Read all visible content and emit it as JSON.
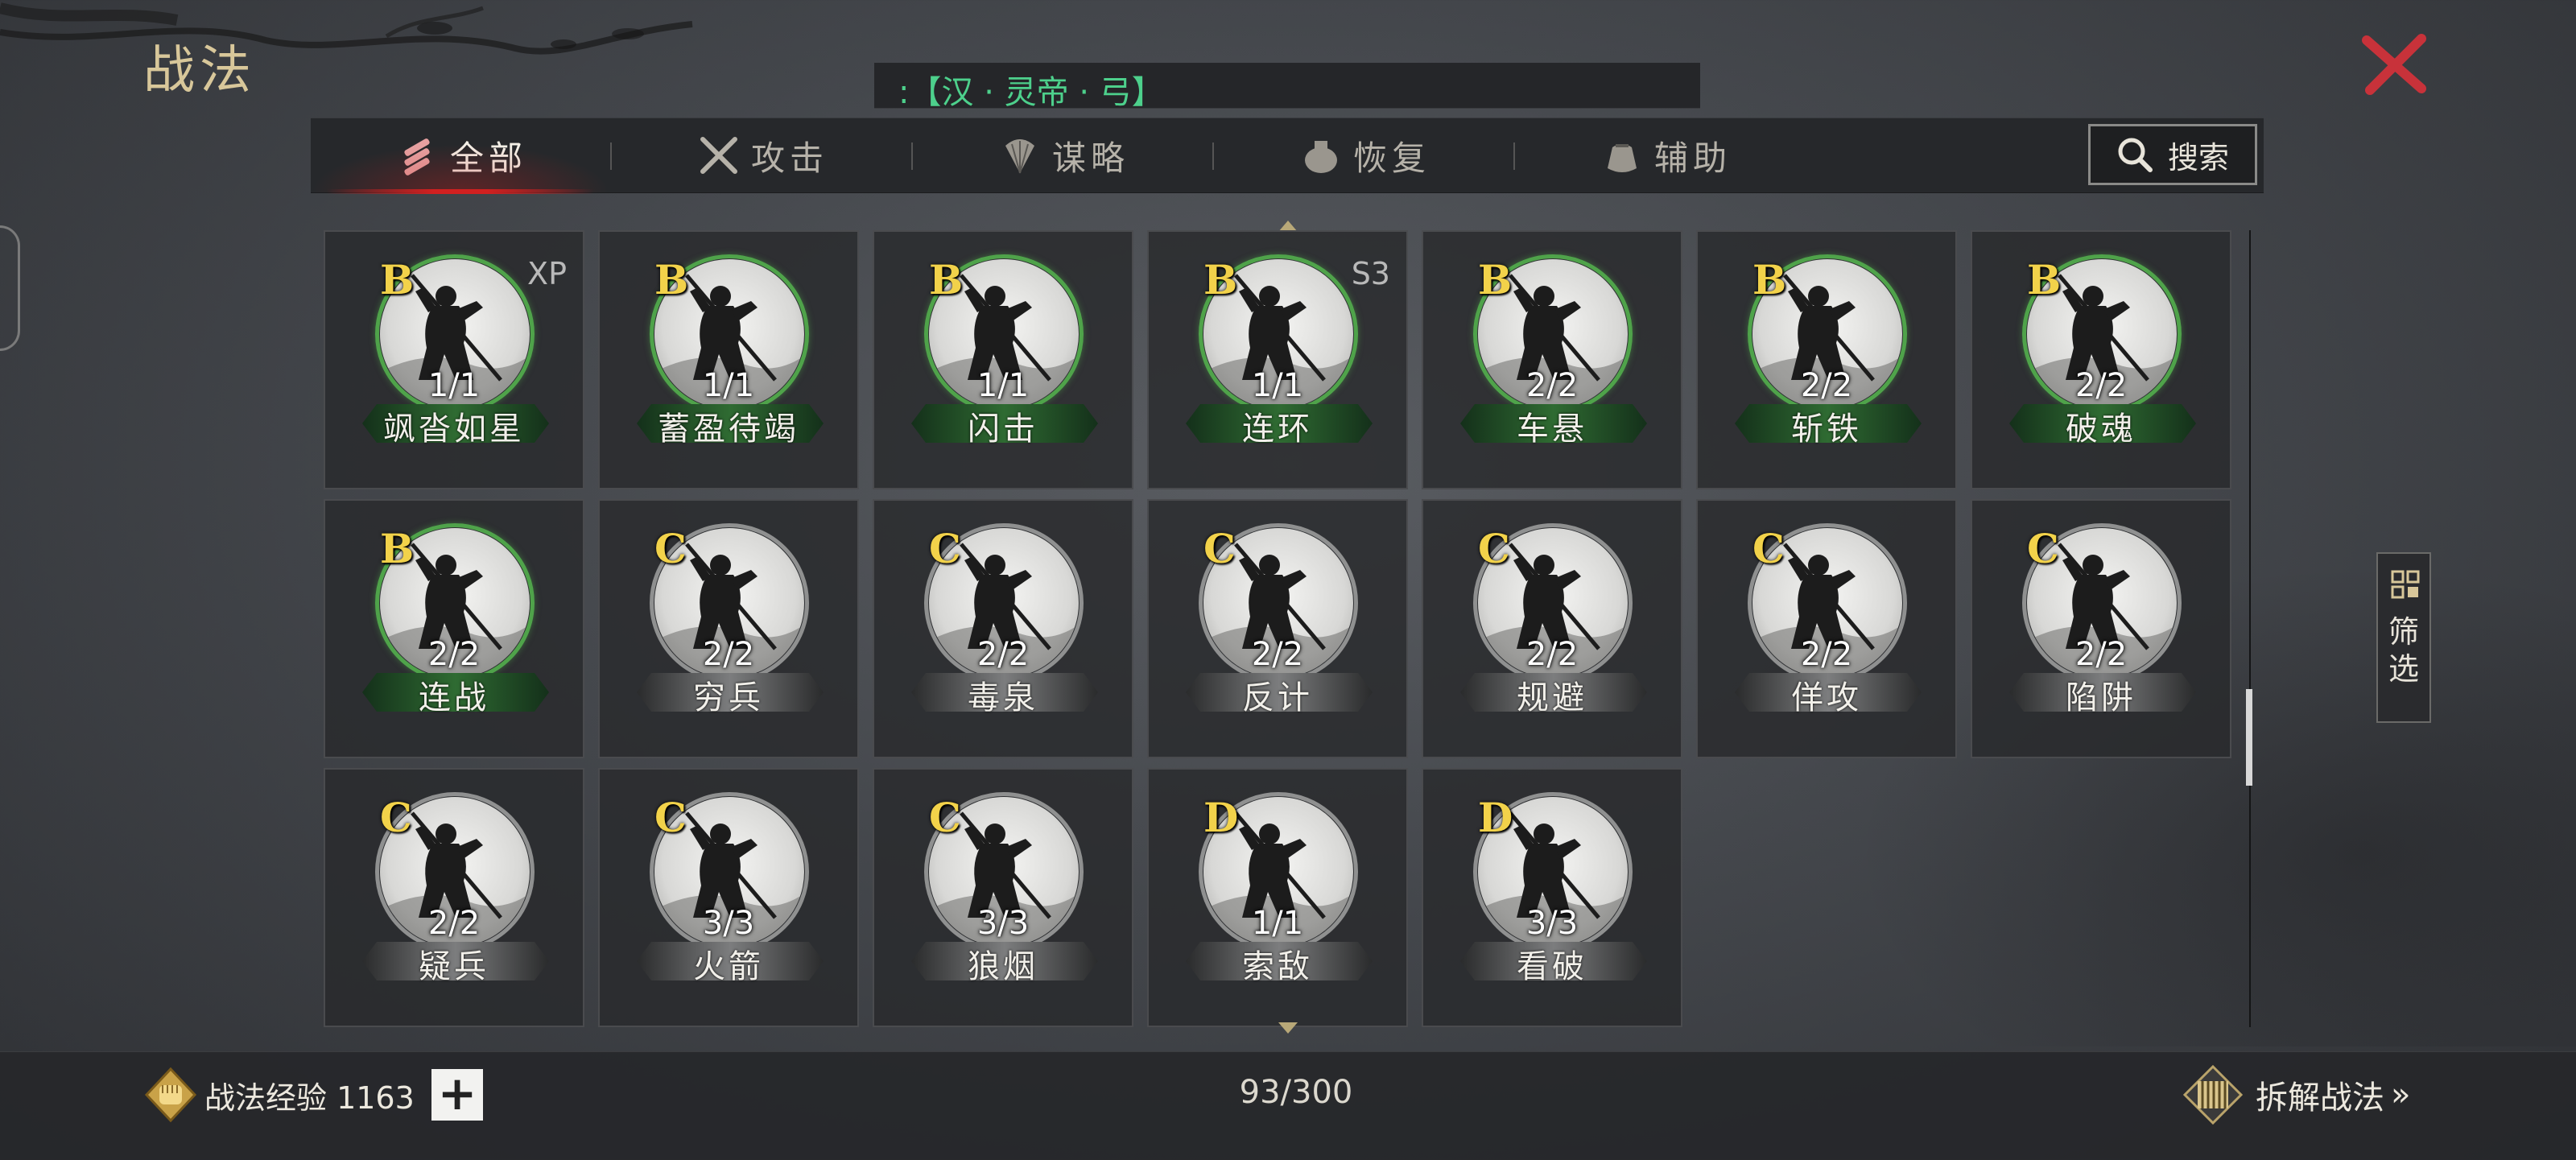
{
  "header": {
    "title": "战法",
    "banner_text": ":【汉 · 灵帝 · 弓】"
  },
  "tabs": [
    {
      "label": "全部",
      "icon": "scroll-bundle-icon",
      "active": true
    },
    {
      "label": "攻击",
      "icon": "crossed-swords-icon",
      "active": false
    },
    {
      "label": "谋略",
      "icon": "feather-fan-icon",
      "active": false
    },
    {
      "label": "恢复",
      "icon": "medicine-pot-icon",
      "active": false
    },
    {
      "label": "辅助",
      "icon": "pouch-icon",
      "active": false
    }
  ],
  "search": {
    "label": "搜索",
    "icon": "magnifier-icon"
  },
  "filter": {
    "label": "筛选",
    "icon": "grid-icon"
  },
  "cards": [
    {
      "grade": "B",
      "level": "1/1",
      "name": "飒沓如星",
      "tag": "XP",
      "tier": "green"
    },
    {
      "grade": "B",
      "level": "1/1",
      "name": "蓄盈待竭",
      "tag": "",
      "tier": "green"
    },
    {
      "grade": "B",
      "level": "1/1",
      "name": "闪击",
      "tag": "",
      "tier": "green"
    },
    {
      "grade": "B",
      "level": "1/1",
      "name": "连环",
      "tag": "S3",
      "tier": "green"
    },
    {
      "grade": "B",
      "level": "2/2",
      "name": "车悬",
      "tag": "",
      "tier": "green"
    },
    {
      "grade": "B",
      "level": "2/2",
      "name": "斩铁",
      "tag": "",
      "tier": "green"
    },
    {
      "grade": "B",
      "level": "2/2",
      "name": "破魂",
      "tag": "",
      "tier": "green"
    },
    {
      "grade": "B",
      "level": "2/2",
      "name": "连战",
      "tag": "",
      "tier": "green"
    },
    {
      "grade": "C",
      "level": "2/2",
      "name": "穷兵",
      "tag": "",
      "tier": "grey"
    },
    {
      "grade": "C",
      "level": "2/2",
      "name": "毒泉",
      "tag": "",
      "tier": "grey"
    },
    {
      "grade": "C",
      "level": "2/2",
      "name": "反计",
      "tag": "",
      "tier": "grey"
    },
    {
      "grade": "C",
      "level": "2/2",
      "name": "规避",
      "tag": "",
      "tier": "grey"
    },
    {
      "grade": "C",
      "level": "2/2",
      "name": "佯攻",
      "tag": "",
      "tier": "grey"
    },
    {
      "grade": "C",
      "level": "2/2",
      "name": "陷阱",
      "tag": "",
      "tier": "grey"
    },
    {
      "grade": "C",
      "level": "2/2",
      "name": "疑兵",
      "tag": "",
      "tier": "grey"
    },
    {
      "grade": "C",
      "level": "3/3",
      "name": "火箭",
      "tag": "",
      "tier": "grey"
    },
    {
      "grade": "C",
      "level": "3/3",
      "name": "狼烟",
      "tag": "",
      "tier": "grey"
    },
    {
      "grade": "D",
      "level": "1/1",
      "name": "索敌",
      "tag": "",
      "tier": "grey"
    },
    {
      "grade": "D",
      "level": "3/3",
      "name": "看破",
      "tag": "",
      "tier": "grey"
    }
  ],
  "footer": {
    "exp_label": "战法经验 1163",
    "count": "93/300",
    "dismantle_label": "拆解战法"
  },
  "colors": {
    "accent_red": "#d22020",
    "grade_gold": "#f2d24a",
    "banner_green": "#4dd08c",
    "ring_green": "#4fa34a"
  }
}
